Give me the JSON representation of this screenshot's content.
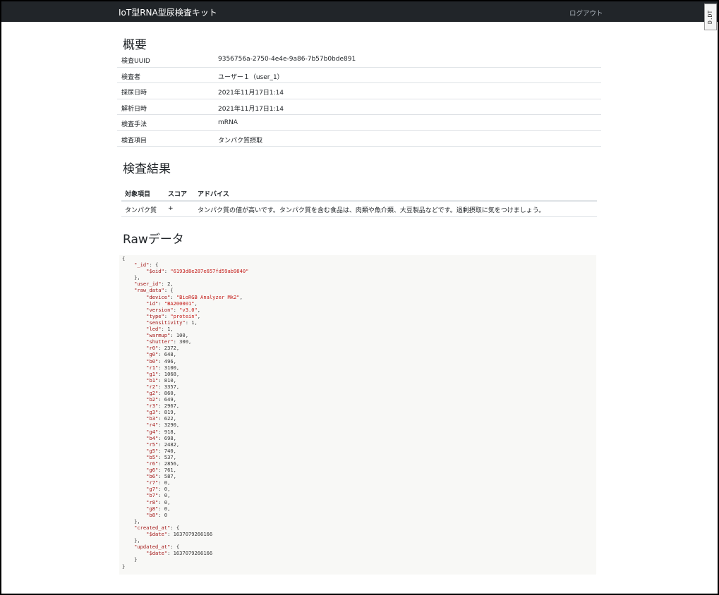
{
  "app": {
    "title": "IoT型RNA型尿検査キット",
    "logout": "ログアウト",
    "badge": "D.DT"
  },
  "overview": {
    "heading": "概要",
    "rows": [
      {
        "label": "検査UUID",
        "value": "9356756a-2750-4e4e-9a86-7b57b0bde891"
      },
      {
        "label": "検査者",
        "value": "ユーザー１（user_1）"
      },
      {
        "label": "採尿日時",
        "value": "2021年11月17日1:14"
      },
      {
        "label": "解析日時",
        "value": "2021年11月17日1:14"
      },
      {
        "label": "検査手法",
        "value": "mRNA"
      },
      {
        "label": "検査項目",
        "value": "タンパク質摂取"
      }
    ]
  },
  "results": {
    "heading": "検査結果",
    "columns": [
      "対象項目",
      "スコア",
      "アドバイス"
    ],
    "rows": [
      {
        "item": "タンパク質",
        "score": "+",
        "advice": "タンパク質の値が高いです。タンパク質を含む食品は、肉類や魚介類、大豆製品などです。過剰摂取に気をつけましょう。"
      }
    ]
  },
  "raw": {
    "heading": "Rawデータ",
    "lines": [
      [
        "",
        "{"
      ],
      [
        "    ",
        "\"_id\"",
        ": {"
      ],
      [
        "        ",
        "\"$oid\"",
        ": ",
        "\"6193d8e287e657fd59ab9840\""
      ],
      [
        "    ",
        "",
        "},"
      ],
      [
        "    ",
        "\"user_id\"",
        ": 2,"
      ],
      [
        "    ",
        "\"raw_data\"",
        ": {"
      ],
      [
        "        ",
        "\"device\"",
        ": ",
        "\"BioRGB Analyzer Mk2\"",
        ","
      ],
      [
        "        ",
        "\"id\"",
        ": ",
        "\"BA200001\"",
        ","
      ],
      [
        "        ",
        "\"version\"",
        ": ",
        "\"v3.0\"",
        ","
      ],
      [
        "        ",
        "\"type\"",
        ": ",
        "\"protein\"",
        ","
      ],
      [
        "        ",
        "\"sensitivity\"",
        ": 1,"
      ],
      [
        "        ",
        "\"led\"",
        ": 1,"
      ],
      [
        "        ",
        "\"warmup\"",
        ": 100,"
      ],
      [
        "        ",
        "\"shutter\"",
        ": 300,"
      ],
      [
        "        ",
        "\"r0\"",
        ": 2372,"
      ],
      [
        "        ",
        "\"g0\"",
        ": 648,"
      ],
      [
        "        ",
        "\"b0\"",
        ": 496,"
      ],
      [
        "        ",
        "\"r1\"",
        ": 3100,"
      ],
      [
        "        ",
        "\"g1\"",
        ": 1068,"
      ],
      [
        "        ",
        "\"b1\"",
        ": 810,"
      ],
      [
        "        ",
        "\"r2\"",
        ": 3357,"
      ],
      [
        "        ",
        "\"g2\"",
        ": 860,"
      ],
      [
        "        ",
        "\"b2\"",
        ": 649,"
      ],
      [
        "        ",
        "\"r3\"",
        ": 2967,"
      ],
      [
        "        ",
        "\"g3\"",
        ": 819,"
      ],
      [
        "        ",
        "\"b3\"",
        ": 622,"
      ],
      [
        "        ",
        "\"r4\"",
        ": 3290,"
      ],
      [
        "        ",
        "\"g4\"",
        ": 918,"
      ],
      [
        "        ",
        "\"b4\"",
        ": 698,"
      ],
      [
        "        ",
        "\"r5\"",
        ": 2482,"
      ],
      [
        "        ",
        "\"g5\"",
        ": 740,"
      ],
      [
        "        ",
        "\"b5\"",
        ": 537,"
      ],
      [
        "        ",
        "\"r6\"",
        ": 2856,"
      ],
      [
        "        ",
        "\"g6\"",
        ": 761,"
      ],
      [
        "        ",
        "\"b6\"",
        ": 587,"
      ],
      [
        "        ",
        "\"r7\"",
        ": 0,"
      ],
      [
        "        ",
        "\"g7\"",
        ": 0,"
      ],
      [
        "        ",
        "\"b7\"",
        ": 0,"
      ],
      [
        "        ",
        "\"r8\"",
        ": 0,"
      ],
      [
        "        ",
        "\"g8\"",
        ": 0,"
      ],
      [
        "        ",
        "\"b8\"",
        ": 0"
      ],
      [
        "    ",
        "",
        "},"
      ],
      [
        "    ",
        "\"created_at\"",
        ": {"
      ],
      [
        "        ",
        "\"$date\"",
        ": 1637079266166"
      ],
      [
        "    ",
        "",
        "},"
      ],
      [
        "    ",
        "\"updated_at\"",
        ": {"
      ],
      [
        "        ",
        "\"$date\"",
        ": 1637079266166"
      ],
      [
        "    ",
        "",
        "}"
      ],
      [
        "",
        "}"
      ]
    ]
  }
}
